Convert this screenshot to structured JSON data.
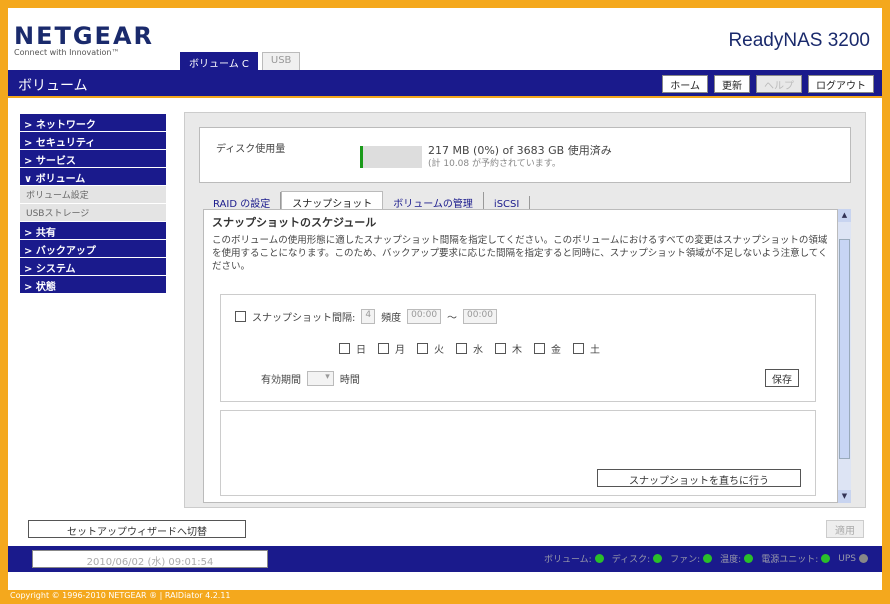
{
  "brand": {
    "logo": "NETGEAR",
    "tagline": "Connect with Innovation™",
    "product": "ReadyNAS 3200"
  },
  "volume_tabs": [
    {
      "label": "ボリューム C",
      "active": true
    },
    {
      "label": "USB",
      "active": false
    }
  ],
  "page_title": "ボリューム",
  "top_buttons": {
    "home": "ホーム",
    "refresh": "更新",
    "help": "ヘルプ",
    "logout": "ログアウト"
  },
  "sidebar": {
    "items": [
      {
        "label": "> ネットワーク"
      },
      {
        "label": "> セキュリティ"
      },
      {
        "label": "> サービス"
      },
      {
        "label": "∨ ボリューム"
      },
      {
        "label": "ボリューム設定"
      },
      {
        "label": "USBストレージ"
      },
      {
        "label": "> 共有"
      },
      {
        "label": "> バックアップ"
      },
      {
        "label": "> システム"
      },
      {
        "label": "> 状態"
      }
    ]
  },
  "disk": {
    "label": "ディスク使用量",
    "usage_fraction": 0.0,
    "usage_text": "217 MB (0%) of 3683 GB 使用済み",
    "reserved_text": "(計 10.08 が予約されています。"
  },
  "content_tabs": [
    {
      "label": "RAID の設定",
      "active": false
    },
    {
      "label": "スナップショット",
      "active": true
    },
    {
      "label": "ボリュームの管理",
      "active": false
    },
    {
      "label": "iSCSI",
      "active": false
    }
  ],
  "snapshot": {
    "section_title": "スナップショットのスケジュール",
    "description": "このボリュームの使用形態に適したスナップショット間隔を指定してください。このボリュームにおけるすべての変更はスナップショットの領域を使用することになります。このため、バックアップ要求に応じた間隔を指定すると同時に、スナップショット領域が不足しないよう注意してください。",
    "interval_label": "スナップショット間隔:",
    "interval_value": "4",
    "frequency_label": "頻度",
    "start_time": "00:00",
    "range_sep": "〜",
    "end_time": "00:00",
    "days": [
      "日",
      "月",
      "火",
      "水",
      "木",
      "金",
      "土"
    ],
    "retention_label": "有効期間",
    "retention_value": "",
    "retention_unit": "時間",
    "save_label": "保存",
    "snap_now_label": "スナップショットを直ちに行う"
  },
  "bottom": {
    "setup_wizard_label": "セットアップウィザードへ切替",
    "apply_label": "適用"
  },
  "status": {
    "datetime": "2010/06/02 (水) 09:01:54",
    "leds": [
      {
        "label": "ボリューム:",
        "color": "#2abf2a"
      },
      {
        "label": "ディスク:",
        "color": "#2abf2a"
      },
      {
        "label": "ファン:",
        "color": "#2abf2a"
      },
      {
        "label": "温度:",
        "color": "#2abf2a"
      },
      {
        "label": "電源ユニット:",
        "color": "#2abf2a"
      },
      {
        "label": "UPS",
        "color": "#888888"
      }
    ]
  },
  "footer": {
    "copyright": "Copyright © 1996-2010 NETGEAR ® | RAIDiator 4.2.11"
  },
  "colors": {
    "brand_blue": "#1a1a8c",
    "frame_orange": "#f4a81d",
    "led_green": "#2abf2a"
  }
}
